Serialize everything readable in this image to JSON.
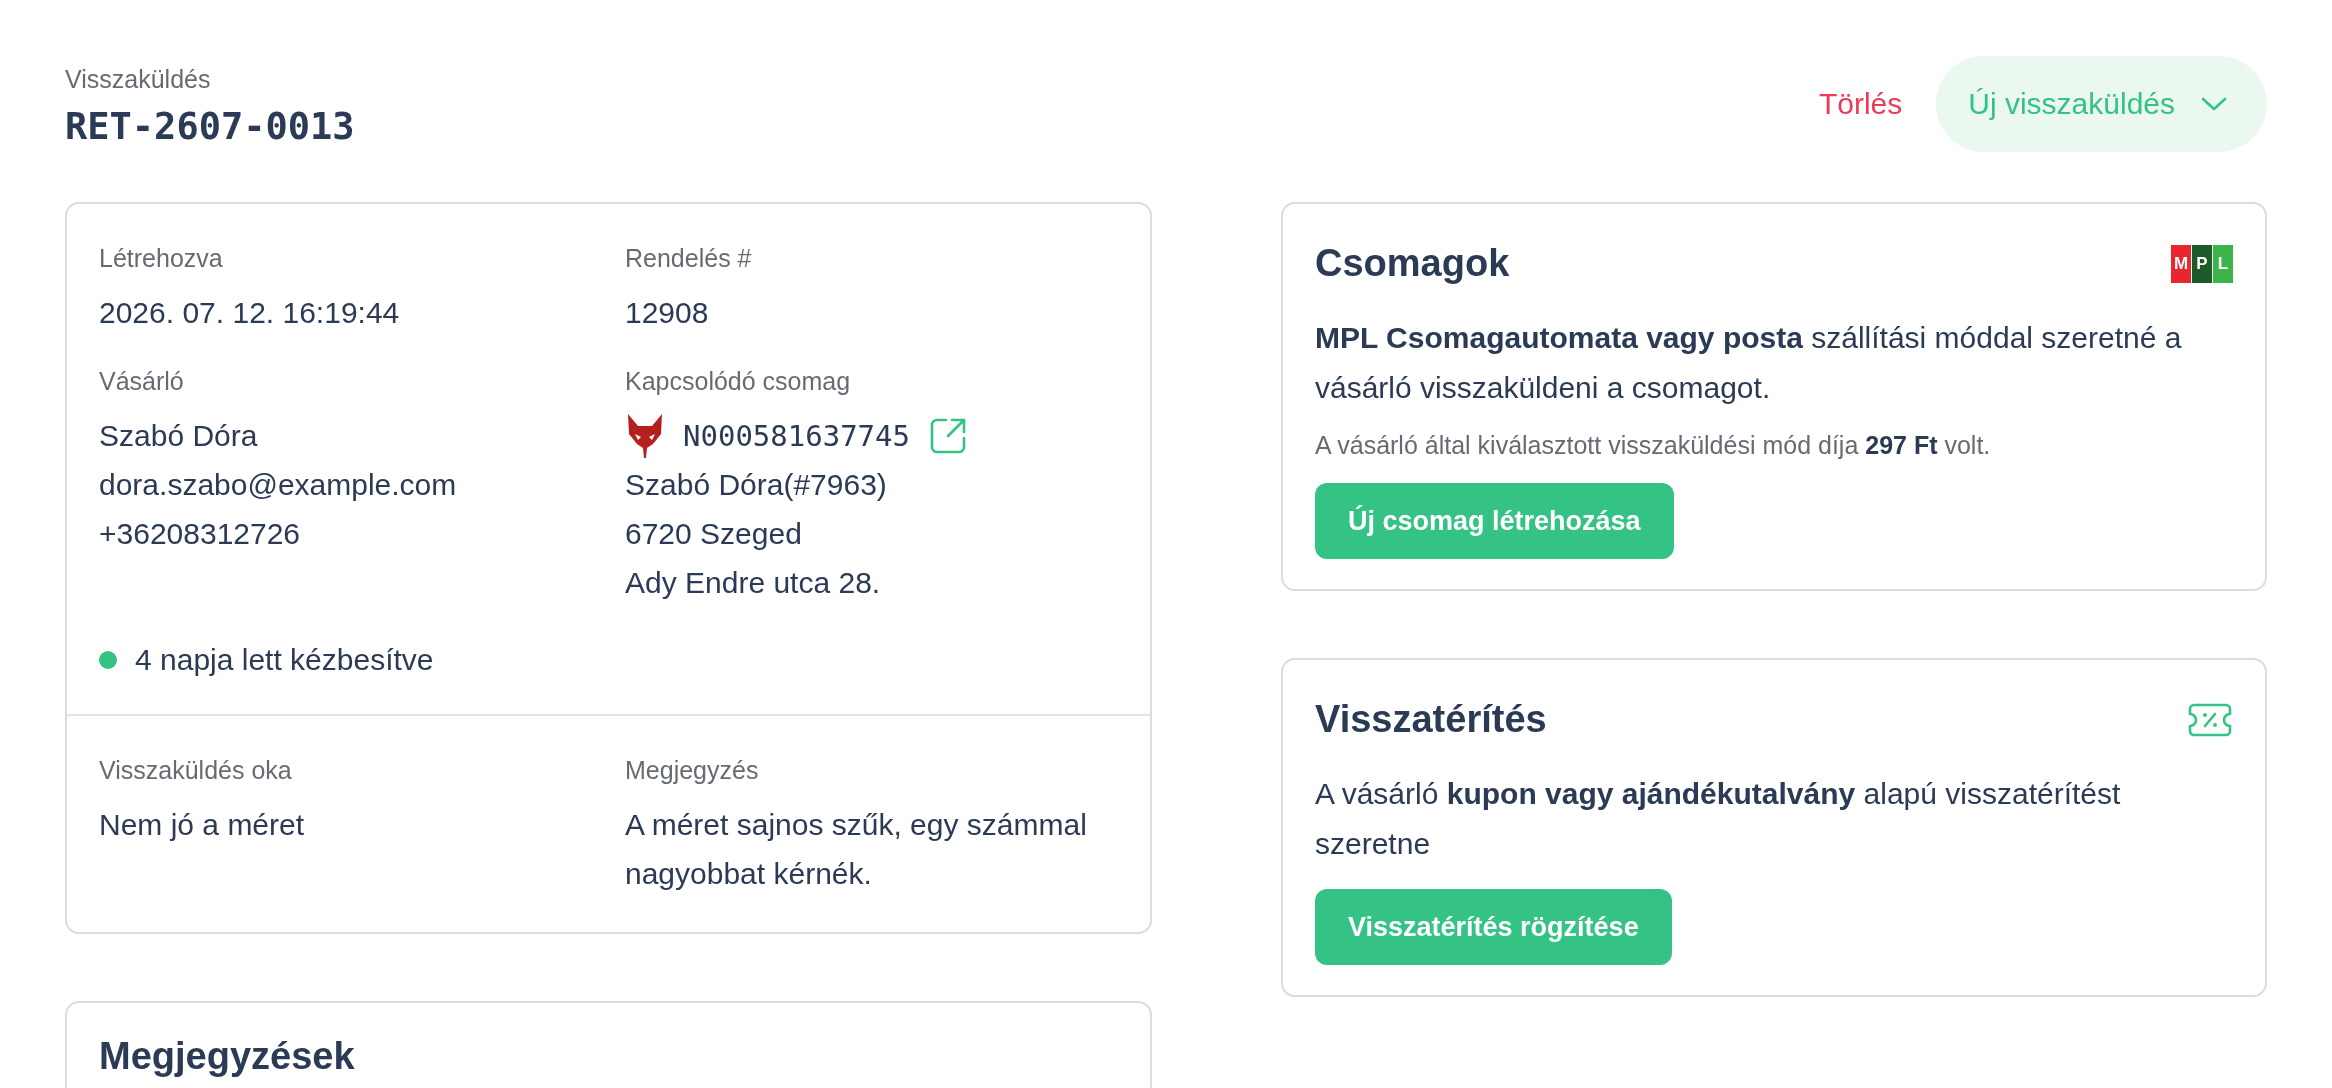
{
  "header": {
    "label": "Visszaküldés",
    "title": "RET-2607-0013",
    "delete_link": "Törlés",
    "new_button": "Új visszaküldés"
  },
  "details": {
    "fields": [
      {
        "label": "Létrehozva",
        "lines": [
          "2026. 07. 12. 16:19:44"
        ]
      },
      {
        "label": "Rendelés #",
        "lines": [
          "12908"
        ]
      },
      {
        "label": "Vásárló",
        "lines": [
          "Szabó Dóra",
          "dora.szabo@example.com",
          "+36208312726"
        ]
      },
      {
        "label": "Kapcsolódó csomag",
        "tracking": "N000581637745",
        "lines": [
          "Szabó Dóra(#7963)",
          "6720 Szeged",
          "Ady Endre utca 28."
        ]
      }
    ],
    "status": {
      "text": "4 napja lett kézbesítve",
      "color": "#34c384"
    },
    "extra_fields": [
      {
        "label": "Visszaküldés oka",
        "lines": [
          "Nem jó a méret"
        ]
      },
      {
        "label": "Megjegyzés",
        "lines": [
          "A méret sajnos szűk, egy számmal nagyobbat kérnék."
        ]
      }
    ]
  },
  "notes": {
    "title": "Megjegyzések"
  },
  "packages": {
    "title": "Csomagok",
    "logo": [
      {
        "letter": "M",
        "color": "#e8262f"
      },
      {
        "letter": "P",
        "color": "#1d5a2a"
      },
      {
        "letter": "L",
        "color": "#3bb54a"
      }
    ],
    "description": "**MPL Csomagautomata vagy posta** szállítási móddal szeretné a vásárló visszaküldeni a csomagot.",
    "fee_note": "A vásárló által kiválasztott visszaküldési mód díja **297 Ft** volt.",
    "button": "Új csomag létrehozása"
  },
  "refund": {
    "title": "Visszatérítés",
    "description": "A vásárló **kupon vagy ajándékutalvány** alapú visszatérítést szeretne",
    "button": "Visszatérítés rögzítése"
  }
}
